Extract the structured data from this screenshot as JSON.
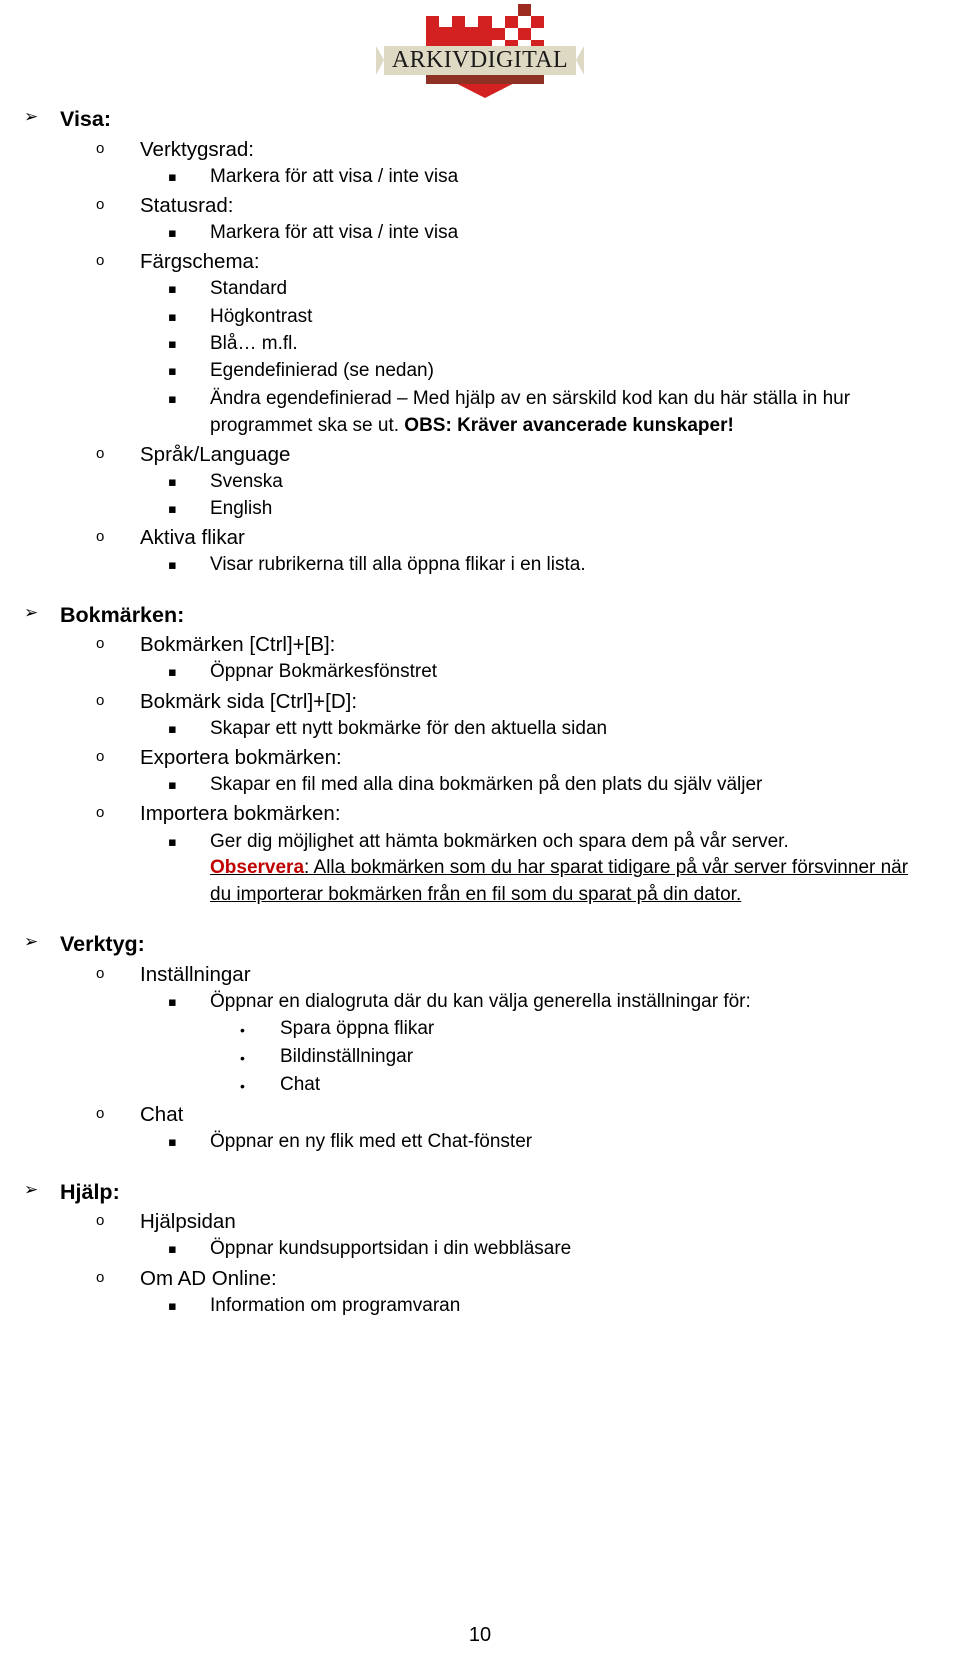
{
  "document": {
    "page_number": "10",
    "brand": {
      "wordmark": "ARKIVDIGITAL",
      "shield_color": "#d32020",
      "banner_color": "#ded9c3",
      "shadow_color": "#8f3024"
    },
    "accent_colors": {
      "observera_red": "#c00000",
      "text_black": "#000000"
    }
  },
  "sections": {
    "visa": {
      "heading": "Visa:",
      "verktygsrad": {
        "label": "Verktygsrad:",
        "detail": "Markera för att visa / inte visa"
      },
      "statusrad": {
        "label": "Statusrad:",
        "detail": "Markera för att visa / inte visa"
      },
      "fargschema": {
        "label": "Färgschema:",
        "options": [
          "Standard",
          "Högkontrast",
          "Blå… m.fl.",
          "Egendefinierad (se nedan)"
        ],
        "andra_egendefinierad": {
          "text": "Ändra egendefinierad – Med hjälp av en särskild kod kan du här ställa in hur programmet ska se ut. ",
          "bold_tail": "OBS: Kräver avancerade kunskaper!"
        }
      },
      "sprak": {
        "label": "Språk/Language",
        "options": [
          "Svenska",
          "English"
        ]
      },
      "aktiva_flikar": {
        "label": "Aktiva flikar",
        "detail": "Visar rubrikerna till alla öppna flikar i en lista."
      }
    },
    "bokmarken": {
      "heading": "Bokmärken:",
      "bokmarken_item": {
        "label": "Bokmärken [Ctrl]+[B]:",
        "detail": "Öppnar Bokmärkesfönstret"
      },
      "bokmark_sida": {
        "label": "Bokmärk sida [Ctrl]+[D]:",
        "detail": "Skapar ett nytt bokmärke för den aktuella sidan"
      },
      "exportera": {
        "label": "Exportera bokmärken:",
        "detail": "Skapar en fil med alla dina bokmärken på den plats du själv väljer"
      },
      "importera": {
        "label": "Importera bokmärken:",
        "detail": "Ger dig möjlighet att hämta bokmärken och spara dem på vår server.",
        "note_label": "Observera",
        "note_separator": ": ",
        "note_text": "Alla bokmärken som du har sparat tidigare på vår server försvinner när du importerar bokmärken från en fil som du sparat på din dator."
      }
    },
    "verktyg": {
      "heading": "Verktyg:",
      "installningar": {
        "label": "Inställningar",
        "detail": "Öppnar en dialogruta där du kan välja generella inställningar för:",
        "options": [
          "Spara öppna flikar",
          "Bildinställningar",
          "Chat"
        ]
      },
      "chat": {
        "label": "Chat",
        "detail": "Öppnar en ny flik med ett Chat-fönster"
      }
    },
    "hjalp": {
      "heading": "Hjälp:",
      "hjalpsidan": {
        "label": "Hjälpsidan",
        "detail": "Öppnar kundsupportsidan i din webbläsare"
      },
      "om_ad_online": {
        "label": "Om AD Online:",
        "detail": "Information om programvaran"
      }
    }
  },
  "markers": {
    "level1": "➢",
    "level2": "o",
    "level3": "▪",
    "level4": "•"
  }
}
